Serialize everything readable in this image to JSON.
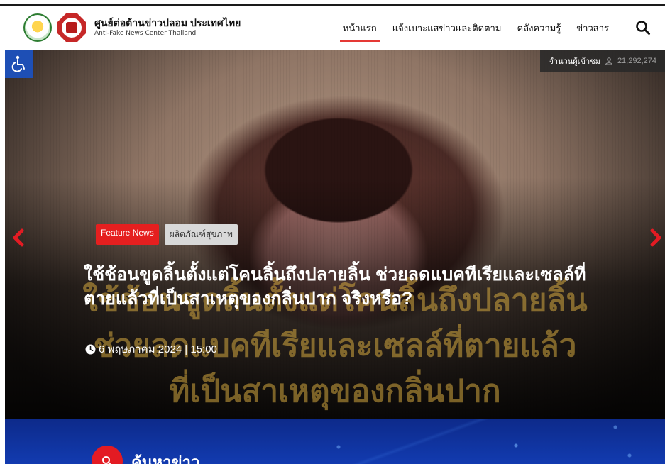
{
  "header": {
    "brand_th": "ศูนย์ต่อต้านข่าวปลอม ประเทศไทย",
    "brand_en": "Anti-Fake News Center Thailand",
    "nav": [
      "หน้าแรก",
      "แจ้งเบาะแสข่าวและติดตาม",
      "คลังความรู้",
      "ข่าวสาร"
    ],
    "active_nav": "หน้าแรก"
  },
  "visitor": {
    "label": "จำนวนผู้เข้าชม",
    "count": "21,292,274"
  },
  "hero": {
    "tags": [
      "Feature News",
      "ผลิตภัณฑ์สุขภาพ"
    ],
    "headline": "ใช้ช้อนขูดลิ้นตั้งแต่โคนลิ้นถึงปลายลิ้น ช่วยลดแบคทีเรียและเซลล์ที่ตายแล้วที่เป็นสาเหตุของกลิ่นปาก จริงหรือ?",
    "date": "6 พฤษภาคม 2024 | 15:00",
    "bg_lines": [
      "ใช้ช้อนขูดลิ้นตั้งแต่โคนลิ้นถึงปลายลิ้น",
      "ช่วยลดแบคทีเรียและเซลล์ที่ตายแล้ว",
      "ที่เป็นสาเหตุของกลิ่นปาก"
    ]
  },
  "search_section": {
    "title": "ค้นหาข่าว"
  },
  "colors": {
    "accent": "#e51f1f",
    "access_blue": "#1e4fb5",
    "search_bg": "#123bb0"
  },
  "icons": [
    "wheelchair-icon",
    "search-icon",
    "clock-icon",
    "user-icon",
    "chevron-left-icon",
    "chevron-right-icon"
  ]
}
